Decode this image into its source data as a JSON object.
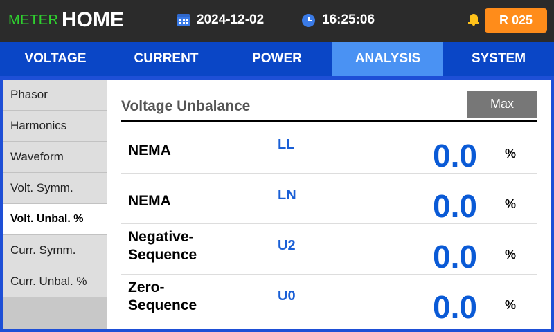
{
  "header": {
    "meter_label": "METER",
    "home_label": "HOME",
    "date": "2024-12-02",
    "time": "16:25:06",
    "badge": "R 025"
  },
  "tabs": [
    {
      "label": "VOLTAGE"
    },
    {
      "label": "CURRENT"
    },
    {
      "label": "POWER"
    },
    {
      "label": "ANALYSIS",
      "active": true
    },
    {
      "label": "SYSTEM"
    }
  ],
  "sidebar": {
    "items": [
      {
        "label": "Phasor"
      },
      {
        "label": "Harmonics"
      },
      {
        "label": "Waveform"
      },
      {
        "label": "Volt. Symm."
      },
      {
        "label": "Volt. Unbal. %",
        "active": true
      },
      {
        "label": "Curr. Symm."
      },
      {
        "label": "Curr. Unbal. %"
      }
    ]
  },
  "main": {
    "title": "Voltage Unbalance",
    "max_button": "Max",
    "rows": [
      {
        "name": "NEMA",
        "code": "LL",
        "value": "0.0",
        "unit": "%"
      },
      {
        "name": "NEMA",
        "code": "LN",
        "value": "0.0",
        "unit": "%"
      },
      {
        "name": "Negative-Sequence",
        "name_line1": "Negative-",
        "name_line2": "Sequence",
        "code": "U2",
        "value": "0.0",
        "unit": "%"
      },
      {
        "name": "Zero-Sequence",
        "name_line1": "Zero-",
        "name_line2": "Sequence",
        "code": "U0",
        "value": "0.0",
        "unit": "%"
      }
    ]
  },
  "colors": {
    "accent_blue": "#0a46c6",
    "active_tab": "#4a92f3",
    "value_blue": "#0a5ad6",
    "badge_orange": "#ff8c1a",
    "meter_green": "#2fd12f"
  }
}
